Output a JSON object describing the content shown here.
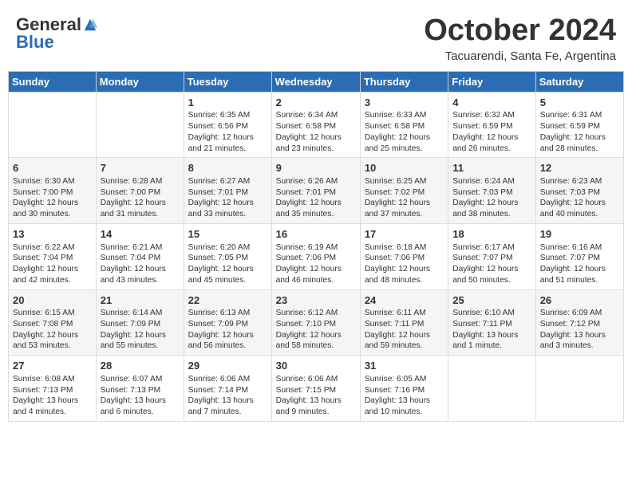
{
  "header": {
    "logo_general": "General",
    "logo_blue": "Blue",
    "month_title": "October 2024",
    "location": "Tacuarendi, Santa Fe, Argentina"
  },
  "days_of_week": [
    "Sunday",
    "Monday",
    "Tuesday",
    "Wednesday",
    "Thursday",
    "Friday",
    "Saturday"
  ],
  "weeks": [
    [
      {
        "day": "",
        "info": ""
      },
      {
        "day": "",
        "info": ""
      },
      {
        "day": "1",
        "info": "Sunrise: 6:35 AM\nSunset: 6:56 PM\nDaylight: 12 hours and 21 minutes."
      },
      {
        "day": "2",
        "info": "Sunrise: 6:34 AM\nSunset: 6:58 PM\nDaylight: 12 hours and 23 minutes."
      },
      {
        "day": "3",
        "info": "Sunrise: 6:33 AM\nSunset: 6:58 PM\nDaylight: 12 hours and 25 minutes."
      },
      {
        "day": "4",
        "info": "Sunrise: 6:32 AM\nSunset: 6:59 PM\nDaylight: 12 hours and 26 minutes."
      },
      {
        "day": "5",
        "info": "Sunrise: 6:31 AM\nSunset: 6:59 PM\nDaylight: 12 hours and 28 minutes."
      }
    ],
    [
      {
        "day": "6",
        "info": "Sunrise: 6:30 AM\nSunset: 7:00 PM\nDaylight: 12 hours and 30 minutes."
      },
      {
        "day": "7",
        "info": "Sunrise: 6:28 AM\nSunset: 7:00 PM\nDaylight: 12 hours and 31 minutes."
      },
      {
        "day": "8",
        "info": "Sunrise: 6:27 AM\nSunset: 7:01 PM\nDaylight: 12 hours and 33 minutes."
      },
      {
        "day": "9",
        "info": "Sunrise: 6:26 AM\nSunset: 7:01 PM\nDaylight: 12 hours and 35 minutes."
      },
      {
        "day": "10",
        "info": "Sunrise: 6:25 AM\nSunset: 7:02 PM\nDaylight: 12 hours and 37 minutes."
      },
      {
        "day": "11",
        "info": "Sunrise: 6:24 AM\nSunset: 7:03 PM\nDaylight: 12 hours and 38 minutes."
      },
      {
        "day": "12",
        "info": "Sunrise: 6:23 AM\nSunset: 7:03 PM\nDaylight: 12 hours and 40 minutes."
      }
    ],
    [
      {
        "day": "13",
        "info": "Sunrise: 6:22 AM\nSunset: 7:04 PM\nDaylight: 12 hours and 42 minutes."
      },
      {
        "day": "14",
        "info": "Sunrise: 6:21 AM\nSunset: 7:04 PM\nDaylight: 12 hours and 43 minutes."
      },
      {
        "day": "15",
        "info": "Sunrise: 6:20 AM\nSunset: 7:05 PM\nDaylight: 12 hours and 45 minutes."
      },
      {
        "day": "16",
        "info": "Sunrise: 6:19 AM\nSunset: 7:06 PM\nDaylight: 12 hours and 46 minutes."
      },
      {
        "day": "17",
        "info": "Sunrise: 6:18 AM\nSunset: 7:06 PM\nDaylight: 12 hours and 48 minutes."
      },
      {
        "day": "18",
        "info": "Sunrise: 6:17 AM\nSunset: 7:07 PM\nDaylight: 12 hours and 50 minutes."
      },
      {
        "day": "19",
        "info": "Sunrise: 6:16 AM\nSunset: 7:07 PM\nDaylight: 12 hours and 51 minutes."
      }
    ],
    [
      {
        "day": "20",
        "info": "Sunrise: 6:15 AM\nSunset: 7:08 PM\nDaylight: 12 hours and 53 minutes."
      },
      {
        "day": "21",
        "info": "Sunrise: 6:14 AM\nSunset: 7:09 PM\nDaylight: 12 hours and 55 minutes."
      },
      {
        "day": "22",
        "info": "Sunrise: 6:13 AM\nSunset: 7:09 PM\nDaylight: 12 hours and 56 minutes."
      },
      {
        "day": "23",
        "info": "Sunrise: 6:12 AM\nSunset: 7:10 PM\nDaylight: 12 hours and 58 minutes."
      },
      {
        "day": "24",
        "info": "Sunrise: 6:11 AM\nSunset: 7:11 PM\nDaylight: 12 hours and 59 minutes."
      },
      {
        "day": "25",
        "info": "Sunrise: 6:10 AM\nSunset: 7:11 PM\nDaylight: 13 hours and 1 minute."
      },
      {
        "day": "26",
        "info": "Sunrise: 6:09 AM\nSunset: 7:12 PM\nDaylight: 13 hours and 3 minutes."
      }
    ],
    [
      {
        "day": "27",
        "info": "Sunrise: 6:08 AM\nSunset: 7:13 PM\nDaylight: 13 hours and 4 minutes."
      },
      {
        "day": "28",
        "info": "Sunrise: 6:07 AM\nSunset: 7:13 PM\nDaylight: 13 hours and 6 minutes."
      },
      {
        "day": "29",
        "info": "Sunrise: 6:06 AM\nSunset: 7:14 PM\nDaylight: 13 hours and 7 minutes."
      },
      {
        "day": "30",
        "info": "Sunrise: 6:06 AM\nSunset: 7:15 PM\nDaylight: 13 hours and 9 minutes."
      },
      {
        "day": "31",
        "info": "Sunrise: 6:05 AM\nSunset: 7:16 PM\nDaylight: 13 hours and 10 minutes."
      },
      {
        "day": "",
        "info": ""
      },
      {
        "day": "",
        "info": ""
      }
    ]
  ]
}
